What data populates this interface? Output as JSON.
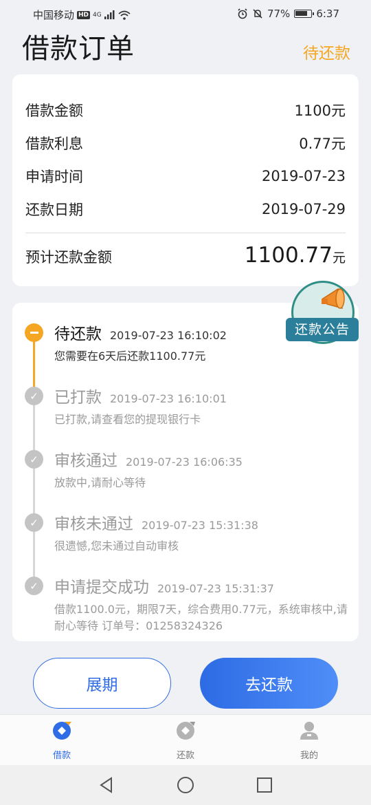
{
  "status_bar": {
    "carrier": "中国移动",
    "hd": "HD",
    "signal": "4G",
    "battery": "77%",
    "time": "6:37"
  },
  "header": {
    "title": "借款订单",
    "status": "待还款"
  },
  "summary": {
    "rows": [
      {
        "label": "借款金额",
        "value": "1100元"
      },
      {
        "label": "借款利息",
        "value": "0.77元"
      },
      {
        "label": "申请时间",
        "value": "2019-07-23"
      },
      {
        "label": "还款日期",
        "value": "2019-07-29"
      }
    ],
    "total_label": "预计还款金额",
    "total_value": "1100.77",
    "total_unit": "元"
  },
  "announcement": {
    "label": "还款公告"
  },
  "timeline": [
    {
      "title": "待还款",
      "time": "2019-07-23 16:10:02",
      "desc": "您需要在6天后还款1100.77元"
    },
    {
      "title": "已打款",
      "time": "2019-07-23 16:10:01",
      "desc": "已打款,请查看您的提现银行卡"
    },
    {
      "title": "审核通过",
      "time": "2019-07-23 16:06:35",
      "desc": "放款中,请耐心等待"
    },
    {
      "title": "审核未通过",
      "time": "2019-07-23 15:31:38",
      "desc": "很遗憾,您未通过自动审核"
    },
    {
      "title": "申请提交成功",
      "time": "2019-07-23 15:31:37",
      "desc": "借款1100.0元，期限7天，综合费用0.77元，系统审核中,请耐心等待 订单号：01258324326"
    }
  ],
  "actions": {
    "extend": "展期",
    "repay": "去还款"
  },
  "tabs": [
    {
      "label": "借款"
    },
    {
      "label": "还款"
    },
    {
      "label": "我的"
    }
  ],
  "colors": {
    "accent": "#2f6ce6",
    "pending": "#f5a623",
    "inactive": "#c4c4c4"
  }
}
